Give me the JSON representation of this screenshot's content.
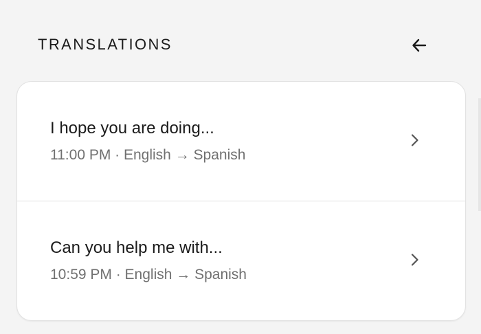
{
  "header": {
    "title": "TRANSLATIONS",
    "back_icon": "arrow-left-icon"
  },
  "translations": [
    {
      "title": "I hope you are doing...",
      "meta": "11:00 PM · English → Spanish",
      "chevron_icon": "chevron-right-icon"
    },
    {
      "title": "Can you help me with...",
      "meta": "10:59 PM · English → Spanish",
      "chevron_icon": "chevron-right-icon"
    }
  ],
  "colors": {
    "background": "#f4f4f4",
    "card": "#ffffff",
    "primary_text": "#1b1b1b",
    "secondary_text": "#707070",
    "divider": "#e1e1e1"
  }
}
